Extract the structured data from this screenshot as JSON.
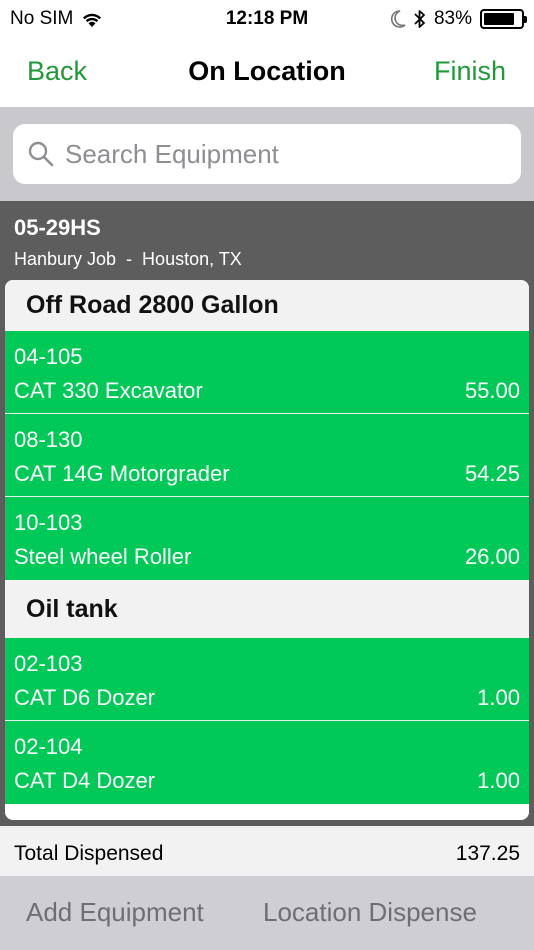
{
  "status_bar": {
    "carrier": "No SIM",
    "time": "12:18 PM",
    "battery_percent": "83%",
    "battery_level": 0.83
  },
  "nav": {
    "back_label": "Back",
    "title": "On Location",
    "finish_label": "Finish"
  },
  "search": {
    "placeholder": "Search Equipment",
    "value": ""
  },
  "job": {
    "code": "05-29HS",
    "location": "Hanbury Job  -  Houston, TX"
  },
  "sections": [
    {
      "title": "Off Road 2800 Gallon",
      "items": [
        {
          "code": "04-105",
          "name": "CAT 330 Excavator",
          "value": "55.00"
        },
        {
          "code": "08-130",
          "name": "CAT 14G Motorgrader",
          "value": "54.25"
        },
        {
          "code": "10-103",
          "name": "Steel wheel Roller",
          "value": "26.00"
        }
      ]
    },
    {
      "title": "Oil tank",
      "items": [
        {
          "code": "02-103",
          "name": "CAT D6 Dozer",
          "value": "1.00"
        },
        {
          "code": "02-104",
          "name": "CAT D4 Dozer",
          "value": "1.00"
        }
      ]
    }
  ],
  "total": {
    "label": "Total Dispensed",
    "value": "137.25"
  },
  "toolbar": {
    "add_label": "Add Equipment",
    "dispense_label": "Location Dispense"
  },
  "colors": {
    "accent": "#1f9a3a",
    "row_green": "#00c957"
  }
}
